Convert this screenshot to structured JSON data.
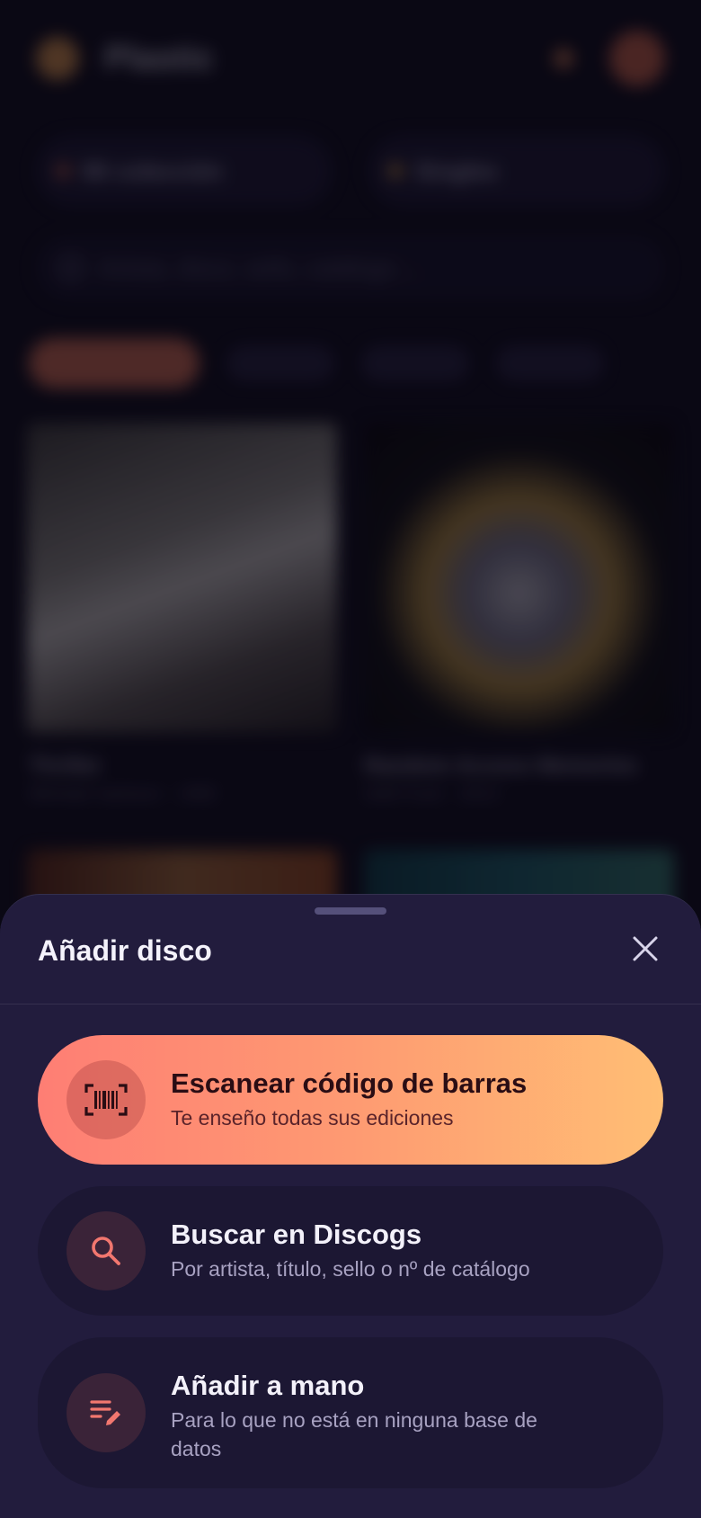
{
  "background": {
    "app_title": "Plastic",
    "filter_collection": "Mi colección",
    "filter_format": "Singles",
    "search_placeholder": "Artista, disco, sello, catálogo…",
    "album_1_title": "Thriller",
    "album_1_sub": "Michael Jackson · 1982",
    "album_2_title": "Random Access Memories",
    "album_2_sub": "Daft Punk · 2013"
  },
  "sheet": {
    "title": "Añadir disco",
    "close_icon": "close-icon",
    "options": [
      {
        "icon": "barcode-scan-icon",
        "title": "Escanear código de barras",
        "subtitle": "Te enseño todas sus ediciones"
      },
      {
        "icon": "search-icon",
        "title": "Buscar en Discogs",
        "subtitle": "Por artista, título, sello o nº de catálogo"
      },
      {
        "icon": "manual-edit-icon",
        "title": "Añadir a mano",
        "subtitle": "Para lo que no está en ninguna base de datos"
      }
    ]
  },
  "colors": {
    "sheet_bg": "#221c3d",
    "primary_gradient_start": "#fe7e74",
    "primary_gradient_end": "#ffbe74",
    "accent_icon": "#f2776f"
  }
}
